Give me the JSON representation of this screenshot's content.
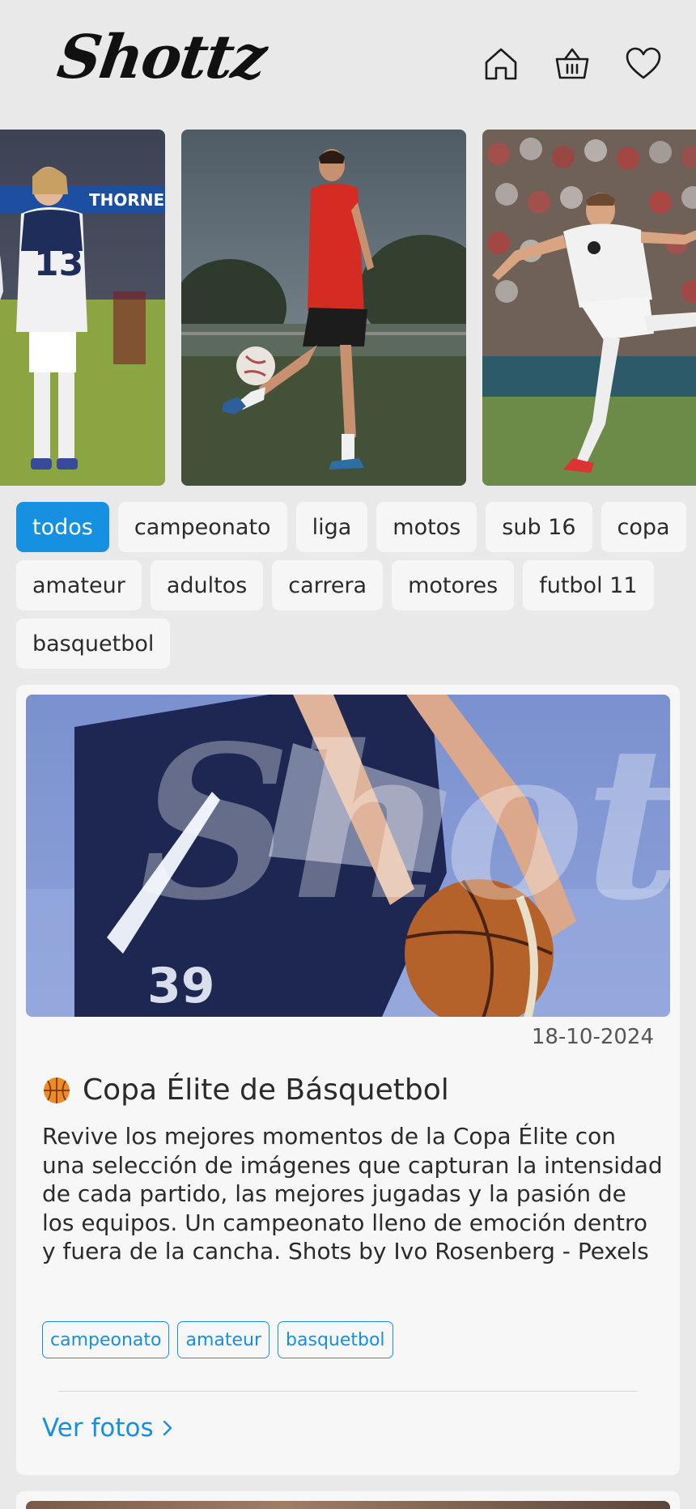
{
  "header": {
    "logo_text": "Shottz",
    "icons": [
      "home-icon",
      "basket-icon",
      "heart-icon"
    ]
  },
  "carousel": {
    "slides": [
      {
        "description": "soccer-players-celebrating",
        "banner_text": "THORNE",
        "jersey_number": "13"
      },
      {
        "description": "player-juggling-ball"
      },
      {
        "description": "player-kicking-ball"
      }
    ]
  },
  "filters": {
    "chips": [
      {
        "label": "todos",
        "active": true
      },
      {
        "label": "campeonato"
      },
      {
        "label": "liga"
      },
      {
        "label": "motos"
      },
      {
        "label": "sub 16"
      },
      {
        "label": "copa"
      },
      {
        "label": "amateur"
      },
      {
        "label": "adultos"
      },
      {
        "label": "carrera"
      },
      {
        "label": "motores"
      },
      {
        "label": "futbol 11"
      },
      {
        "label": "basquetbol"
      }
    ]
  },
  "card": {
    "date": "18-10-2024",
    "emoji_icon": "basketball-icon",
    "title": "Copa Élite de Básquetbol",
    "description": "Revive los mejores momentos de la Copa Élite con una selección de imágenes que capturan la intensidad de cada partido, las mejores jugadas y la pasión de los equipos. Un campeonato lleno de emoción dentro y fuera de la cancha. Shots by Ivo Rosenberg - Pexels",
    "image_jersey_number": "39",
    "tags": [
      "campeonato",
      "amateur",
      "basquetbol"
    ],
    "link_label": "Ver fotos"
  },
  "colors": {
    "accent": "#1690e0",
    "background": "#e9e9ea",
    "card": "#f7f7f7"
  }
}
